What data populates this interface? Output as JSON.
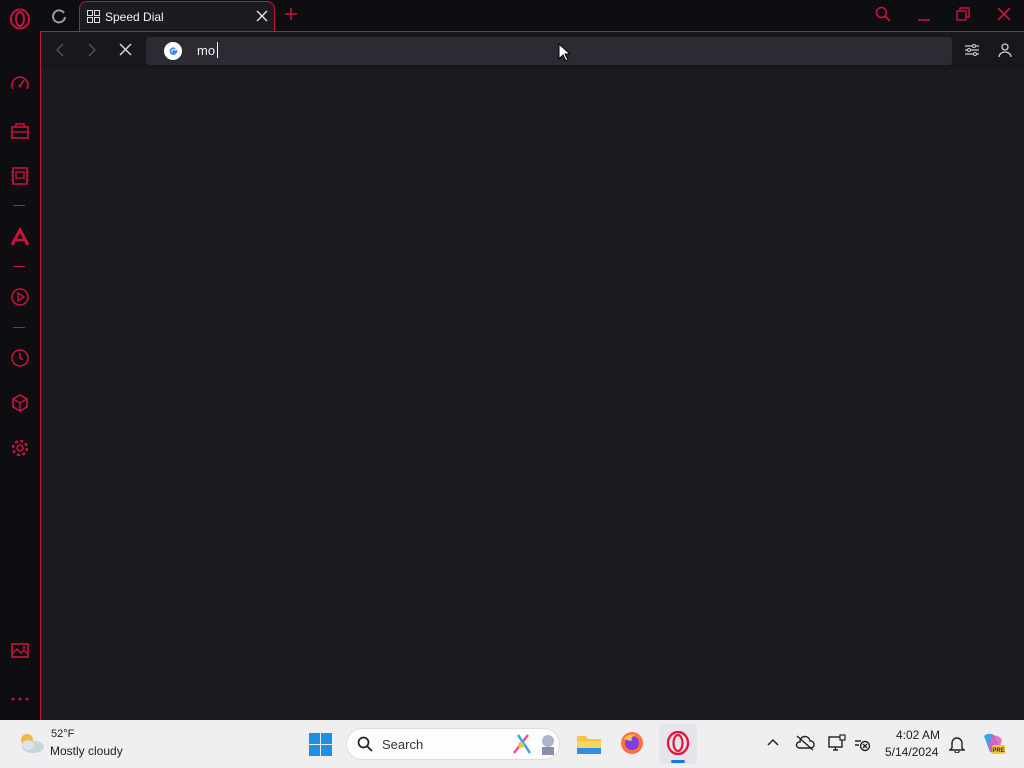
{
  "browser": {
    "tab": {
      "title": "Speed Dial"
    },
    "address_bar": {
      "value": "mo",
      "search_engine_icon": "google-g-icon"
    },
    "toolbar_icons": [
      "back-arrow-icon",
      "forward-arrow-icon",
      "stop-loading-icon",
      "easy-setup-icon",
      "account-icon"
    ],
    "window_controls": [
      "search-tabs-icon",
      "minimize-icon",
      "restore-icon",
      "close-icon"
    ],
    "sidebar_icons": [
      "speed-dial-icon",
      "shopping-bag-icon",
      "news-icon",
      "aria-icon",
      "player-icon",
      "history-icon",
      "extensions-icon",
      "settings-icon",
      "gallery-icon",
      "more-icon"
    ],
    "accent_color": "#c8143a"
  },
  "taskbar": {
    "weather": {
      "temp": "52°F",
      "desc": "Mostly cloudy"
    },
    "search": {
      "label": "Search"
    },
    "clock": {
      "time": "4:02 AM",
      "date": "5/14/2024"
    },
    "pinned_apps": [
      "windows-start-icon",
      "file-explorer-icon",
      "firefox-icon",
      "opera-gx-icon"
    ],
    "tray_icons": [
      "show-hidden-icons-chevron",
      "onedrive-icon",
      "display-icon",
      "network-icon",
      "notifications-bell-icon",
      "copilot-icon"
    ]
  }
}
